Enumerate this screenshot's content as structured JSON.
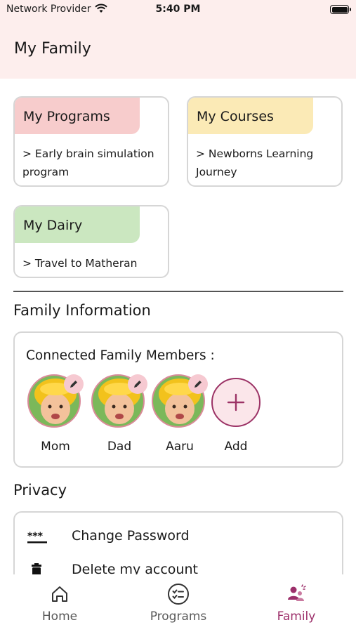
{
  "status_bar": {
    "carrier": "Network Provider",
    "time": "5:40 PM"
  },
  "header": {
    "title": "My Family"
  },
  "cards": {
    "programs": {
      "title": "My Programs",
      "desc": "> Early brain simulation program",
      "color": "#f7cccc"
    },
    "courses": {
      "title": "My Courses",
      "desc": "> Newborns Learning Journey",
      "color": "#fbeab6"
    },
    "dairy": {
      "title": "My Dairy",
      "desc": "> Travel to Matheran",
      "color": "#cbe7c0"
    }
  },
  "family_info": {
    "section_title": "Family Information",
    "members_title": "Connected Family Members :",
    "members": [
      {
        "name": "Mom",
        "icon": "pencil-icon"
      },
      {
        "name": "Dad",
        "icon": "pencil-icon"
      },
      {
        "name": "Aaru",
        "icon": "pencil-icon"
      }
    ],
    "add_label": "Add"
  },
  "privacy": {
    "section_title": "Privacy",
    "items": [
      {
        "label": "Change Password",
        "icon": "password-icon"
      },
      {
        "label": "Delete my account",
        "icon": "trash-icon"
      }
    ]
  },
  "bottom_nav": {
    "items": [
      {
        "label": "Home",
        "icon": "home-icon"
      },
      {
        "label": "Programs",
        "icon": "checklist-icon"
      },
      {
        "label": "Family",
        "icon": "family-icon",
        "active": true
      }
    ],
    "active_color": "#9c2f6a"
  },
  "colors": {
    "header_bg": "#fdeeed",
    "accent": "#9c2f6a",
    "add_circle_bg": "#fbe6ea",
    "edit_badge_bg": "#f6c9d1"
  }
}
